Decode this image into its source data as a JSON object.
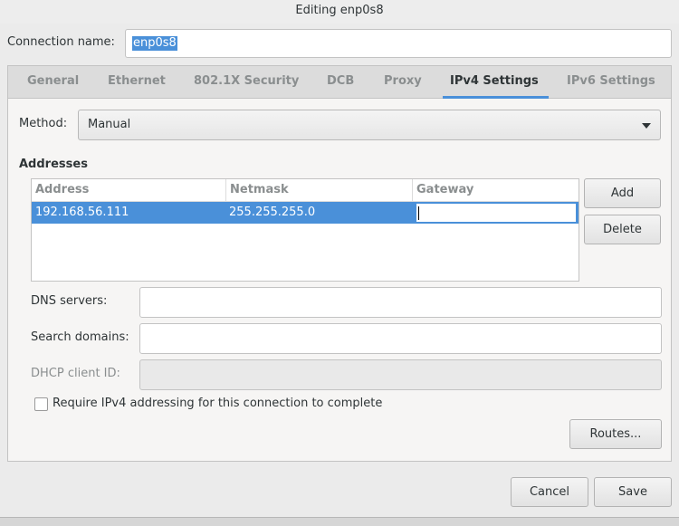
{
  "window": {
    "title": "Editing enp0s8"
  },
  "connection": {
    "label": "Connection name:",
    "value": "enp0s8"
  },
  "tabs": [
    {
      "label": "General"
    },
    {
      "label": "Ethernet"
    },
    {
      "label": "802.1X Security"
    },
    {
      "label": "DCB"
    },
    {
      "label": "Proxy"
    },
    {
      "label": "IPv4 Settings",
      "active": true
    },
    {
      "label": "IPv6 Settings"
    }
  ],
  "ipv4": {
    "method_label": "Method:",
    "method_value": "Manual",
    "addresses_title": "Addresses",
    "columns": [
      "Address",
      "Netmask",
      "Gateway"
    ],
    "rows": [
      {
        "address": "192.168.56.111",
        "netmask": "255.255.255.0",
        "gateway": ""
      }
    ],
    "add_label": "Add",
    "delete_label": "Delete",
    "dns_label": "DNS servers:",
    "dns_value": "",
    "search_label": "Search domains:",
    "search_value": "",
    "dhcp_label": "DHCP client ID:",
    "dhcp_value": "",
    "require_label": "Require IPv4 addressing for this connection to complete",
    "require_checked": false,
    "routes_label": "Routes..."
  },
  "footer": {
    "cancel_label": "Cancel",
    "save_label": "Save"
  },
  "colors": {
    "accent": "#4a90d9",
    "background": "#f6f5f4"
  }
}
